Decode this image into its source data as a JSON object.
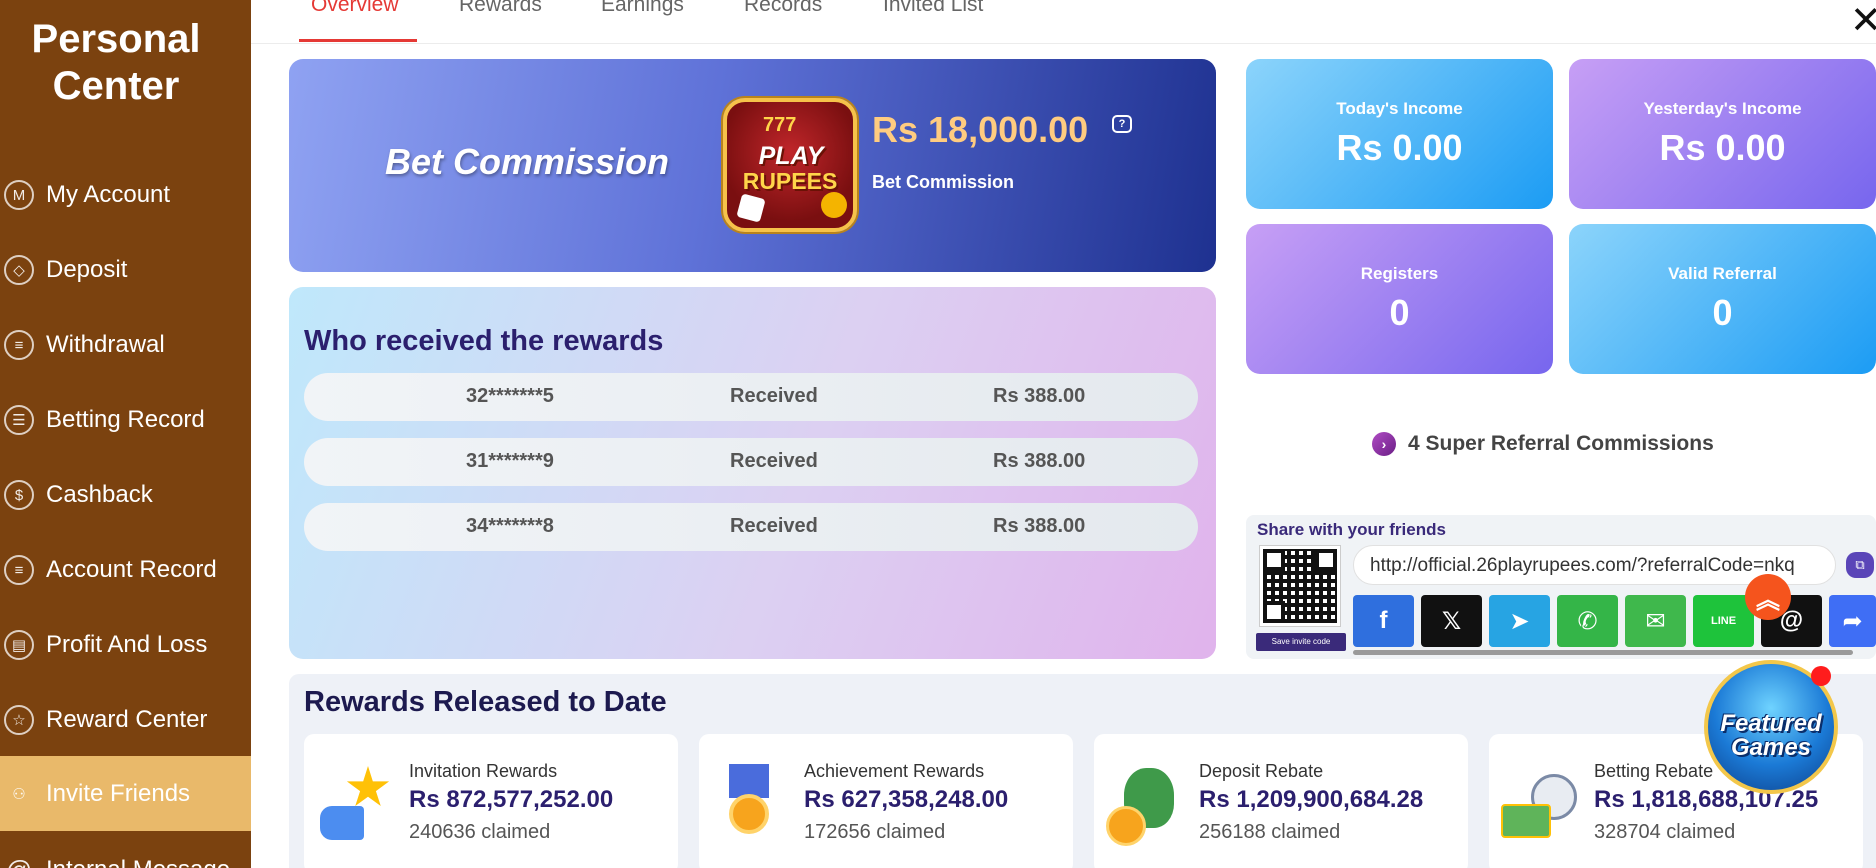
{
  "sidebar": {
    "title": "Personal\nCenter",
    "items": [
      {
        "label": "My Account",
        "icon": "M"
      },
      {
        "label": "Deposit",
        "icon": "◇"
      },
      {
        "label": "Withdrawal",
        "icon": "≡"
      },
      {
        "label": "Betting Record",
        "icon": "☰"
      },
      {
        "label": "Cashback",
        "icon": "$"
      },
      {
        "label": "Account Record",
        "icon": "≡"
      },
      {
        "label": "Profit And Loss",
        "icon": "▤"
      },
      {
        "label": "Reward Center",
        "icon": "☆"
      },
      {
        "label": "Invite Friends",
        "icon": "⚇"
      },
      {
        "label": "Internal Message",
        "icon": "@"
      }
    ]
  },
  "tabs": [
    "Overview",
    "Rewards",
    "Earnings",
    "Records",
    "Invited List"
  ],
  "close_icon": "✕",
  "bet": {
    "title": "Bet Commission",
    "amount": "Rs  18,000.00",
    "subtitle": "Bet Commission",
    "logo": {
      "top": "777",
      "line1": "PLAY",
      "line2": "RUPEES"
    }
  },
  "stats": [
    {
      "label": "Today's Income",
      "value": "Rs  0.00"
    },
    {
      "label": "Yesterday's Income",
      "value": "Rs  0.00"
    },
    {
      "label": "Registers",
      "value": "0"
    },
    {
      "label": "Valid Referral",
      "value": "0"
    }
  ],
  "rewards_list": {
    "title": "Who received the rewards",
    "rows": [
      {
        "user": "32*******5",
        "status": "Received",
        "amount": "Rs  388.00"
      },
      {
        "user": "31*******9",
        "status": "Received",
        "amount": "Rs  388.00"
      },
      {
        "user": "34*******8",
        "status": "Received",
        "amount": "Rs  388.00"
      }
    ]
  },
  "super_referral": "4 Super Referral Commissions",
  "share": {
    "title": "Share with your friends",
    "url": "http://official.26playrupees.com/?referralCode=nkq",
    "qr_button": "Save invite code",
    "socials": [
      {
        "name": "facebook",
        "glyph": "f",
        "color": "#2f6fde"
      },
      {
        "name": "x",
        "glyph": "𝕏",
        "color": "#111111"
      },
      {
        "name": "telegram",
        "glyph": "➤",
        "color": "#27a4e3"
      },
      {
        "name": "whatsapp",
        "glyph": "✆",
        "color": "#34b548"
      },
      {
        "name": "sms",
        "glyph": "✉",
        "color": "#3fb84c"
      },
      {
        "name": "line",
        "glyph": "LINE",
        "color": "#1ec33b"
      },
      {
        "name": "threads",
        "glyph": "@",
        "color": "#111111"
      },
      {
        "name": "share",
        "glyph": "➦",
        "color": "#3f6ef5"
      }
    ]
  },
  "released": {
    "title": "Rewards Released to Date",
    "cards": [
      {
        "label": "Invitation Rewards",
        "amount": "Rs  872,577,252.00",
        "claimed": "240636 claimed"
      },
      {
        "label": "Achievement Rewards",
        "amount": "Rs  627,358,248.00",
        "claimed": "172656 claimed"
      },
      {
        "label": "Deposit Rebate",
        "amount": "Rs  1,209,900,684.28",
        "claimed": "256188 claimed"
      },
      {
        "label": "Betting Rebate",
        "amount": "Rs  1,818,688,107.25",
        "claimed": "328704 claimed"
      }
    ]
  },
  "featured": "Featured\nGames",
  "colors": {
    "sidebar": "#7b420f",
    "active_item": "#e9b96a",
    "tab_active": "#e53935",
    "back_to_top": "#f5541d"
  }
}
